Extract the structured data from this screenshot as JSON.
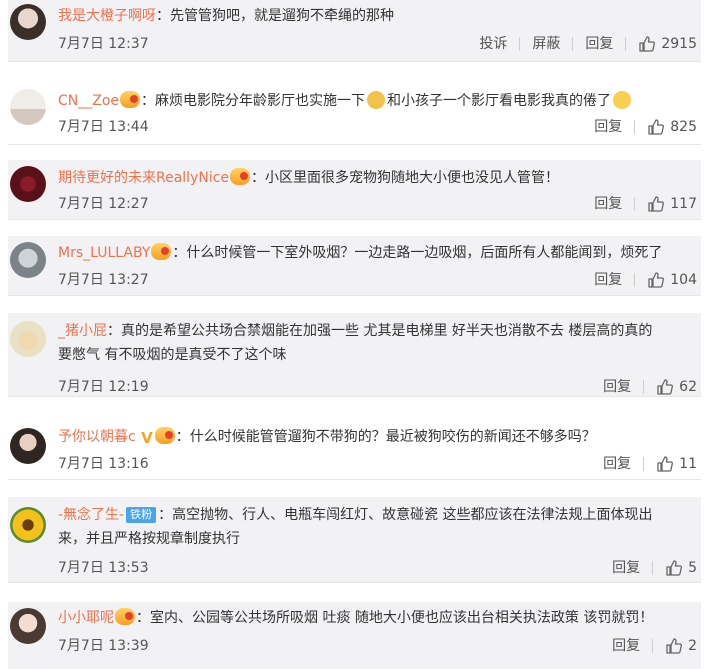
{
  "comments": [
    {
      "user": "我是大橙子啊呀",
      "badge": false,
      "text": "：先管管狗吧，就是遛狗不牵绳的那种",
      "time": "7月7日 12:37",
      "actions": [
        "投诉",
        "屏蔽",
        "回复"
      ],
      "likes": "2915"
    },
    {
      "user": "CN__Zoe",
      "badge": true,
      "text_a": "：麻烦电影院分年龄影厅也实施一下",
      "text_b": "和小孩子一个影厅看电影我真的倦了",
      "time": "7月7日 13:44",
      "actions": [
        "回复"
      ],
      "likes": "825"
    },
    {
      "user": "期待更好的未来ReallyNice",
      "badge": true,
      "text": "：小区里面很多宠物狗随地大小便也没见人管管！",
      "time": "7月7日 12:27",
      "actions": [
        "回复"
      ],
      "likes": "117"
    },
    {
      "user": "Mrs_LULLABY",
      "badge": true,
      "text": "：什么时候管一下室外吸烟？一边走路一边吸烟，后面所有人都能闻到，烦死了",
      "time": "7月7日 13:27",
      "actions": [
        "回复"
      ],
      "likes": "104"
    },
    {
      "user": "_猪小屁",
      "badge": false,
      "text_1": "：真的是希望公共场合禁烟能在加强一些 尤其是电梯里 好半天也消散不去 楼层高的真的",
      "text_2": "要憋气 有不吸烟的是真受不了这个味",
      "time": "7月7日 12:19",
      "actions": [
        "回复"
      ],
      "likes": "62"
    },
    {
      "user": "予你以朝暮c",
      "badge": true,
      "vip": "V",
      "text": "：什么时候能管管遛狗不带狗的？最近被狗咬伤的新闻还不够多吗？",
      "time": "7月7日 13:16",
      "actions": [
        "回复"
      ],
      "likes": "11"
    },
    {
      "user": "-無念了生-",
      "fan_tag": "铁粉",
      "text_1": "：高空抛物、行人、电瓶车闯红灯、故意碰瓷 这些都应该在法律法规上面体现出",
      "text_2": "来，并且严格按规章制度执行",
      "time": "7月7日 13:53",
      "actions": [
        "回复"
      ],
      "likes": "5"
    },
    {
      "user": "小小耶呢",
      "badge": true,
      "text": "：室内、公园等公共场所吸烟 吐痰 随地大小便也应该出台相关执法政策 该罚就罚！",
      "time": "7月7日 13:39",
      "actions": [
        "回复"
      ],
      "likes": "2"
    }
  ],
  "colors": {
    "username": "#eb7350",
    "text": "#333333",
    "meta": "#555555",
    "shaded_row": "#f2f2f5"
  },
  "icons": {
    "like": "thumbs-up-icon",
    "badge": "member-badge-icon"
  }
}
